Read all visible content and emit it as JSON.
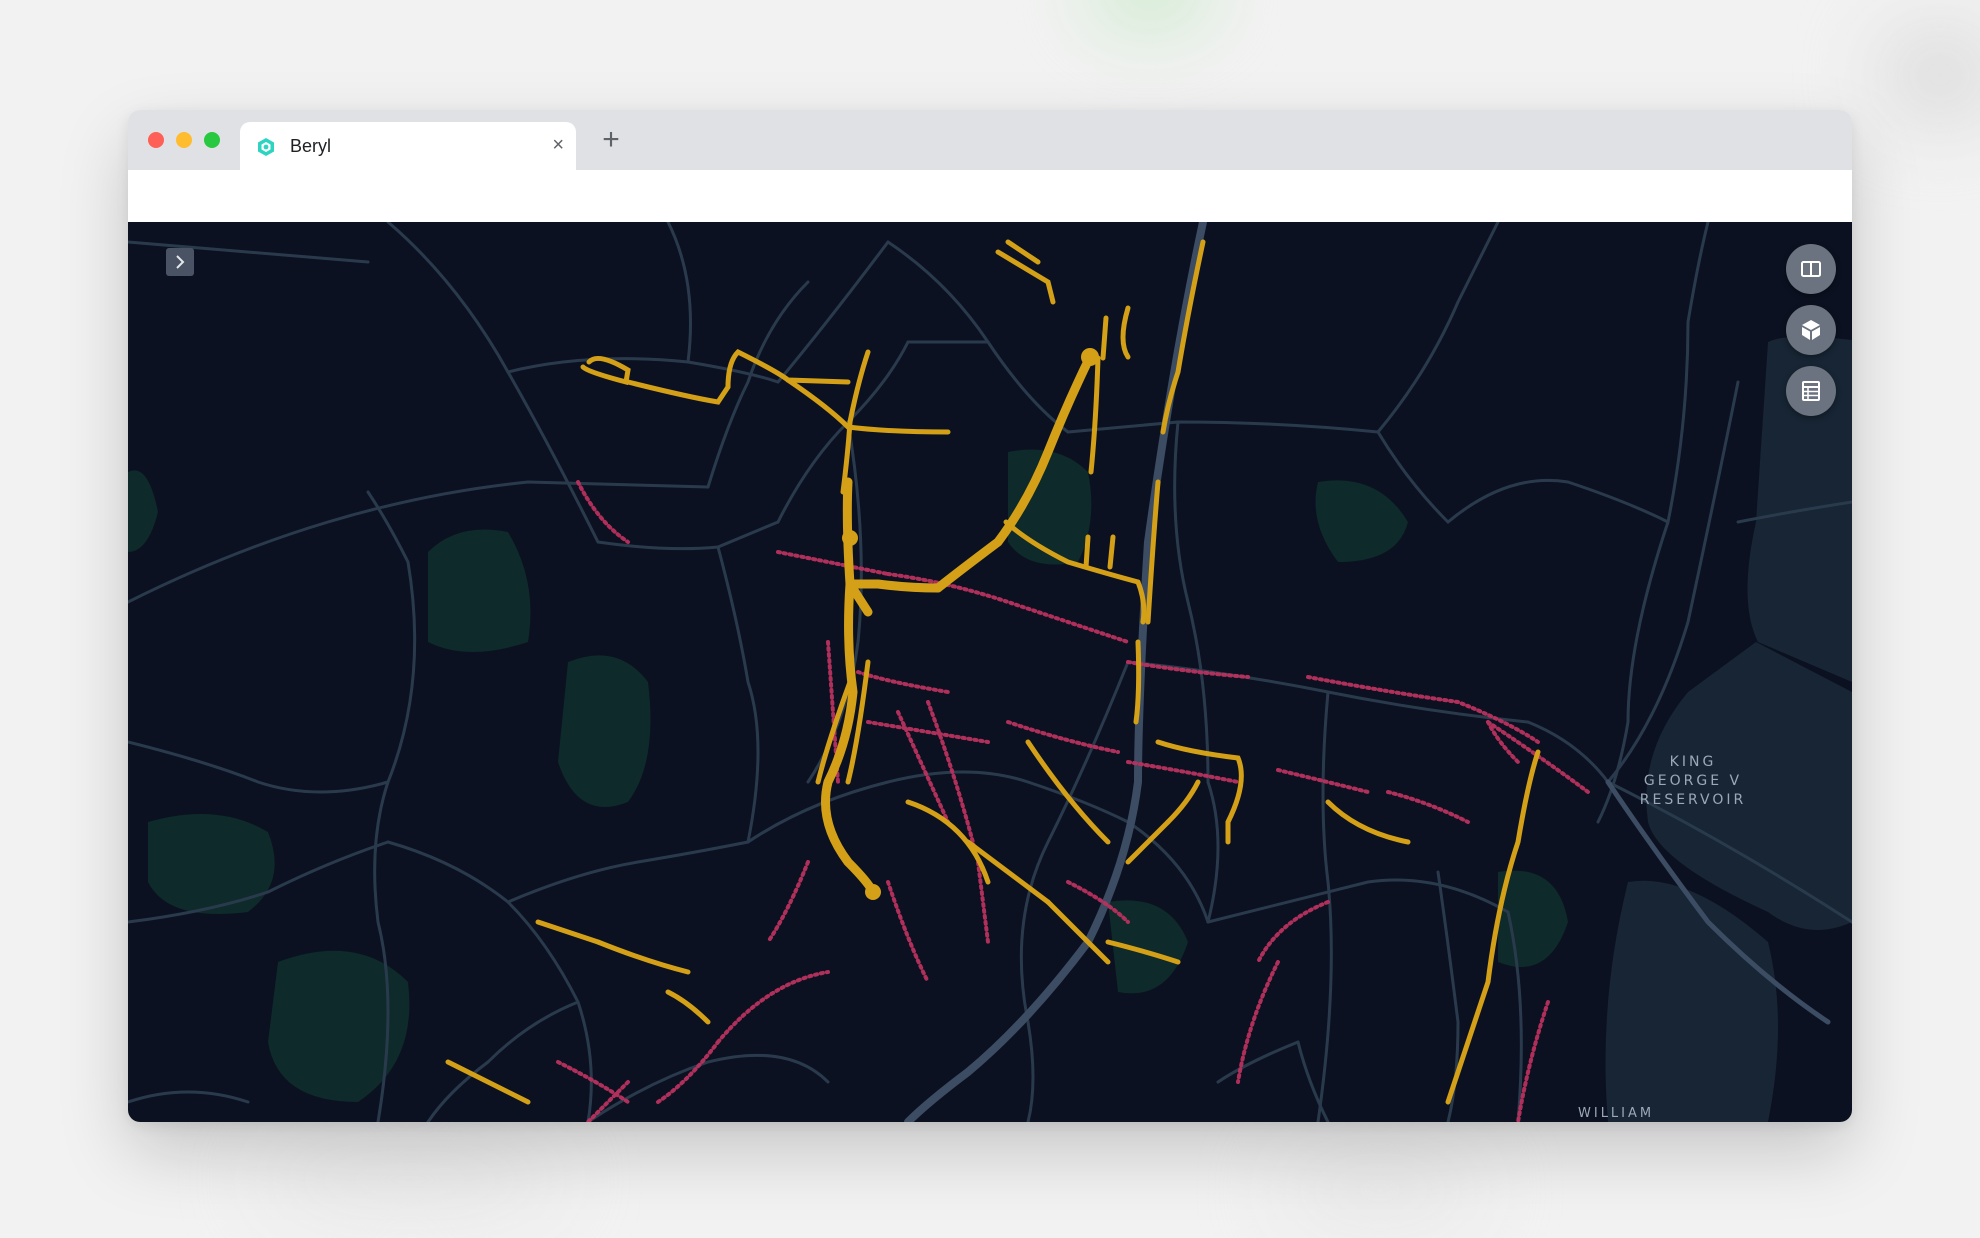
{
  "browser": {
    "tab_title": "Beryl",
    "close_glyph": "×",
    "new_tab_glyph": "+"
  },
  "map": {
    "labels": {
      "reservoir_line1": "KING",
      "reservoir_line2": "GEORGE V",
      "reservoir_line3": "RESERVOIR",
      "bottom_partial": "WILLIAM"
    },
    "controls": {
      "expand_icon": "chevron-right-icon",
      "buttons": [
        "book-icon",
        "cube-icon",
        "table-icon"
      ]
    },
    "colors": {
      "background": "#0b1120",
      "roads": "#2a3a4d",
      "major_road": "#3b4c63",
      "parks": "#0e2a2a",
      "water": "#172534",
      "heat_high": "#d4a017",
      "heat_low": "#b8325e"
    }
  }
}
